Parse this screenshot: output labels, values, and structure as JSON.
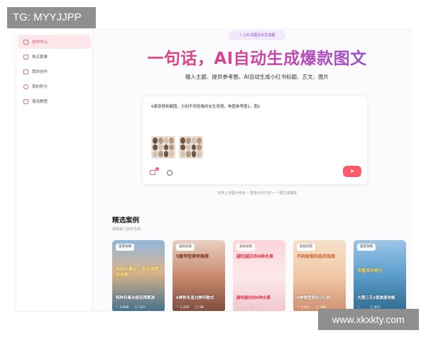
{
  "watermarks": {
    "top": "TG: MYYJJPP",
    "bottom": "www.xkxkty.com"
  },
  "sidebar": {
    "items": [
      {
        "label": "创作中心",
        "icon": "pen-icon",
        "active": true
      },
      {
        "label": "购买套餐",
        "icon": "package-icon",
        "active": false
      },
      {
        "label": "我的创作",
        "icon": "document-icon",
        "active": false
      },
      {
        "label": "我的积分",
        "icon": "clock-icon",
        "active": false
      },
      {
        "label": "使用教程",
        "icon": "book-icon",
        "active": false
      }
    ]
  },
  "hero": {
    "badge": "✧ 小红书图文AI生成器",
    "title": "一句话，AI自动生成爆款图文",
    "subtitle": "输入主题、提供参考图，AI自动生成小红书标题、正文、图片"
  },
  "input": {
    "prompt": "6套穿搭拆解图，分别不同性格的女生穿搭，构图参考图1，图2",
    "attachment_count": "2",
    "send_icon": "send-icon"
  },
  "steps_hint": "支持上传图片参考 • 智能分析内容 • 一键生成爆款",
  "showcase": {
    "title": "精选案例",
    "subtitle": "探索热门创作灵感",
    "cards": [
      {
        "tag": "旅游攻略",
        "headline": "特种兵集合 / 超低预算游攻略",
        "caption": "特种兵集合超低预算游",
        "likes": "4,908",
        "comments": "321"
      },
      {
        "tag": "美妆穿搭",
        "headline": "5套甲型美甲推荐",
        "caption": "6种秋冬显白美甲款式",
        "likes": "1,269",
        "comments": "98"
      },
      {
        "tag": "美妆穿搭",
        "headline": "越吃越白的6种水果",
        "caption": "越吃越白的6种水果",
        "likes": "…",
        "comments": "…"
      },
      {
        "tag": "美妆穿搭",
        "headline": "不同体型的选衣指南",
        "caption": "6种体型穿衣小心机",
        "likes": "2,241",
        "comments": "186"
      },
      {
        "tag": "旅游攻略",
        "headline": "去看风的地方",
        "caption": "大理三天2夜旅游攻略",
        "likes": "…",
        "comments": "851"
      }
    ]
  },
  "colors": {
    "accent": "#e14a63",
    "send": "#ff5d6c",
    "title_from": "#e63e78",
    "title_to": "#9552d6"
  }
}
